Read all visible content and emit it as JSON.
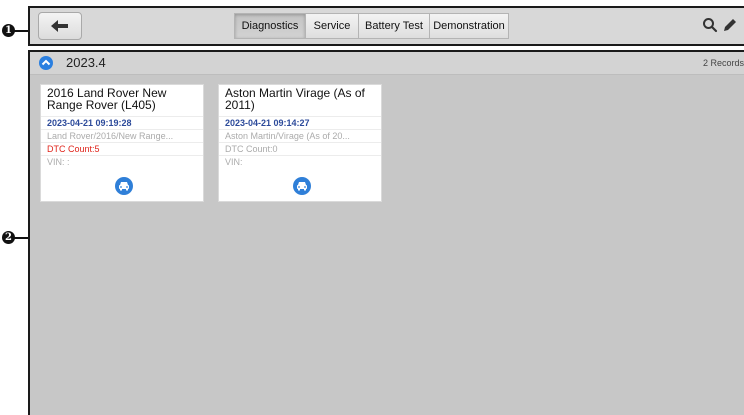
{
  "callouts": {
    "toolbar": "1",
    "content": "2"
  },
  "toolbar": {
    "tabs": [
      {
        "label": "Diagnostics",
        "active": true
      },
      {
        "label": "Service",
        "active": false
      },
      {
        "label": "Battery Test",
        "active": false
      },
      {
        "label": "Demonstration",
        "active": false
      }
    ],
    "icons": [
      "back-arrow-icon",
      "search-icon",
      "edit-pencil-icon"
    ]
  },
  "group": {
    "title": "2023.4",
    "records": "2 Records"
  },
  "records": [
    {
      "title": "2016 Land Rover New Range Rover (L405)",
      "date": "2023-04-21 09:19:28",
      "model": "Land Rover/2016/New Range...",
      "dtc": "DTC Count:5",
      "vin": "VIN: :"
    },
    {
      "title": "Aston Martin Virage (As of 2011)",
      "date": "2023-04-21 09:14:27",
      "model": "Aston Martin/Virage (As of 20...",
      "dtc": "DTC Count:0",
      "vin": "VIN:"
    }
  ],
  "colors": {
    "accent": "#2a7fe0",
    "date": "#2c4a9a",
    "dtc_alert": "#e0241b",
    "content_bg": "#c7c7c7"
  }
}
